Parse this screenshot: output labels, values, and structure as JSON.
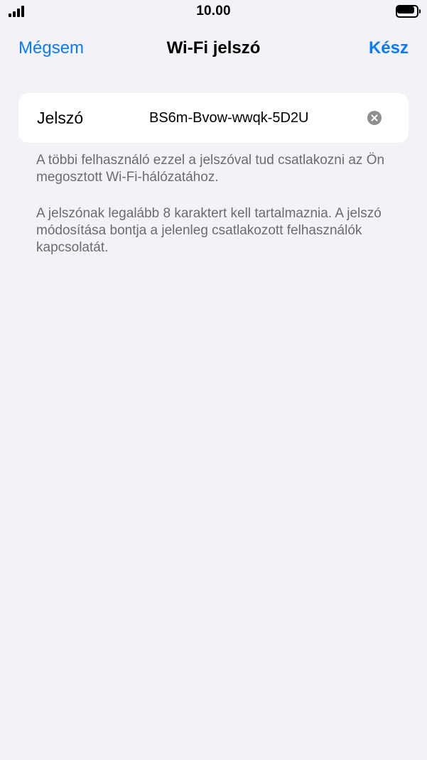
{
  "status_bar": {
    "time": "10.00",
    "signal_icon": "cellular-signal-icon",
    "battery_icon": "battery-icon",
    "battery_level": 1.0
  },
  "nav": {
    "cancel_label": "Mégsem",
    "title": "Wi-Fi jelszó",
    "done_label": "Kész"
  },
  "password_field": {
    "label": "Jelszó",
    "value": "BS6m-Bvow-wwqk-5D2U",
    "clear_icon": "clear-icon"
  },
  "footer": {
    "line1": "A többi felhasználó ezzel a jelszóval tud csatlakozni az Ön megosztott Wi-Fi-hálózatához.",
    "line2": "A jelszónak legalább 8 karaktert kell tartalmaznia. A jelszó módosítása bontja a jelenleg csatlakozott felhasználók kapcsolatát."
  },
  "colors": {
    "accent": "#0a7aff",
    "background": "#f2f2f7",
    "cell_background": "#ffffff",
    "secondary_text": "#6c6c70"
  }
}
